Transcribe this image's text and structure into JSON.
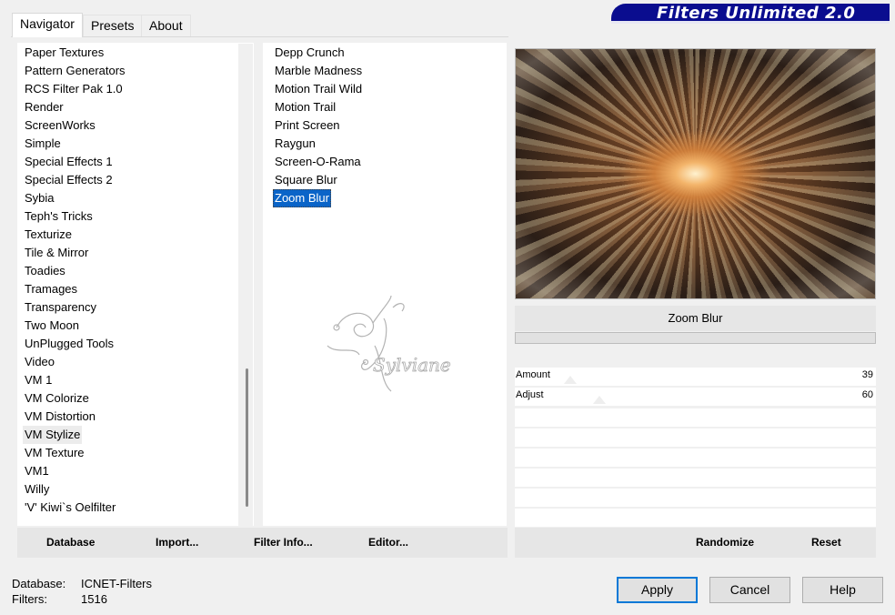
{
  "banner": {
    "title": "Filters Unlimited 2.0"
  },
  "tabs": [
    {
      "label": "Navigator"
    },
    {
      "label": "Presets"
    },
    {
      "label": "About"
    }
  ],
  "categories": [
    "Paper Textures",
    "Pattern Generators",
    "RCS Filter Pak 1.0",
    "Render",
    "ScreenWorks",
    "Simple",
    "Special Effects 1",
    "Special Effects 2",
    "Sybia",
    "Teph's Tricks",
    "Texturize",
    "Tile & Mirror",
    "Toadies",
    "Tramages",
    "Transparency",
    "Two Moon",
    "UnPlugged Tools",
    "Video",
    "VM 1",
    "VM Colorize",
    "VM Distortion",
    "VM Stylize",
    "VM Texture",
    "VM1",
    "Willy",
    "'V' Kiwi`s Oelfilter"
  ],
  "selected_category": "VM Stylize",
  "filters": [
    "Depp Crunch",
    "Marble Madness",
    "Motion Trail Wild",
    "Motion Trail",
    "Print Screen",
    "Raygun",
    "Screen-O-Rama",
    "Square Blur",
    "Zoom Blur"
  ],
  "selected_filter": "Zoom Blur",
  "watermark_text": "Sylviane",
  "preview": {
    "filter_name": "Zoom Blur"
  },
  "params": [
    {
      "label": "Amount",
      "value": "39",
      "level": 39
    },
    {
      "label": "Adjust",
      "value": "60",
      "level": 60
    }
  ],
  "left_toolbar": {
    "database": "Database",
    "import": "Import...",
    "filter_info": "Filter Info...",
    "editor": "Editor..."
  },
  "right_toolbar": {
    "randomize": "Randomize",
    "reset": "Reset"
  },
  "status": {
    "database_label": "Database:",
    "database_value": "ICNET-Filters",
    "filters_label": "Filters:",
    "filters_value": "1516"
  },
  "buttons": {
    "apply": "Apply",
    "cancel": "Cancel",
    "help": "Help"
  }
}
